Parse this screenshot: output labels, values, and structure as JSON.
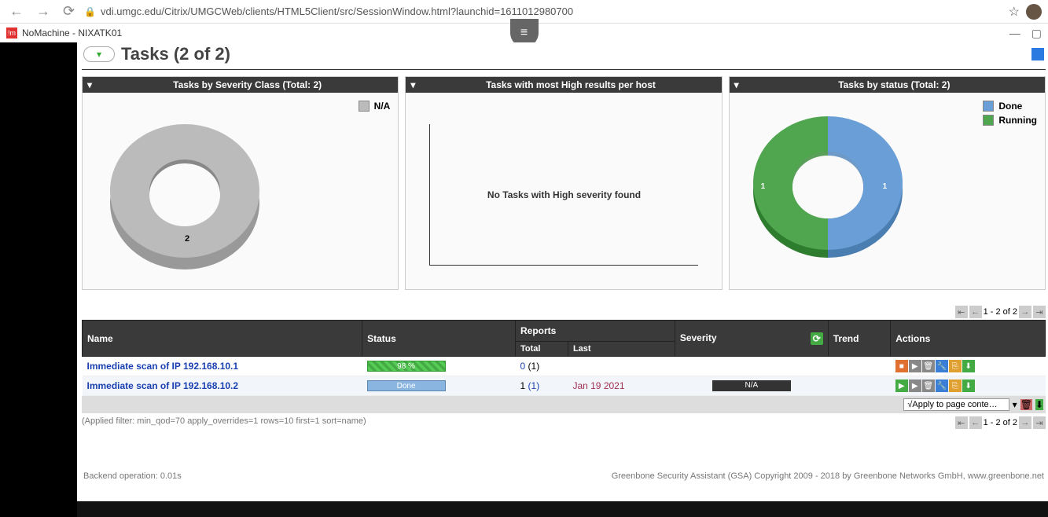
{
  "browser": {
    "url": "vdi.umgc.edu/Citrix/UMGCWeb/clients/HTML5Client/src/SessionWindow.html?launchid=1611012980700"
  },
  "taskbar": {
    "app_title": "NoMachine - NIXATK01"
  },
  "page_title": "Tasks (2 of 2)",
  "panels": {
    "severity": {
      "title": "Tasks by Severity Class (Total: 2)",
      "legend_na": "N/A",
      "count_label": "2"
    },
    "high": {
      "title": "Tasks with most High results per host",
      "empty_msg": "No Tasks with High severity found"
    },
    "status": {
      "title": "Tasks by status (Total: 2)",
      "legend_done": "Done",
      "legend_running": "Running",
      "count_done": "1",
      "count_running": "1"
    }
  },
  "pager": {
    "text": "1 - 2 of 2"
  },
  "table": {
    "headers": {
      "name": "Name",
      "status": "Status",
      "reports": "Reports",
      "total": "Total",
      "last": "Last",
      "severity": "Severity",
      "trend": "Trend",
      "actions": "Actions"
    },
    "rows": [
      {
        "name": "Immediate scan of IP 192.168.10.1",
        "status_pct": "98 %",
        "total_a": "0",
        "total_b": "(1)",
        "last": "",
        "severity": ""
      },
      {
        "name": "Immediate scan of IP 192.168.10.2",
        "status_done": "Done",
        "total_a": "1",
        "total_b": "(1)",
        "last": "Jan 19 2021",
        "severity": "N/A"
      }
    ]
  },
  "apply_dropdown": "√Apply to page conte…",
  "filter_note": "(Applied filter: min_qod=70 apply_overrides=1 rows=10 first=1 sort=name)",
  "backend": "Backend operation: 0.01s",
  "footer": "Greenbone Security Assistant (GSA) Copyright 2009 - 2018 by Greenbone Networks GmbH, www.greenbone.net",
  "chart_data": [
    {
      "type": "pie",
      "title": "Tasks by Severity Class (Total: 2)",
      "series": [
        {
          "name": "N/A",
          "value": 2
        }
      ]
    },
    {
      "type": "bar",
      "title": "Tasks with most High results per host",
      "categories": [],
      "values": [],
      "note": "No Tasks with High severity found"
    },
    {
      "type": "pie",
      "title": "Tasks by status (Total: 2)",
      "series": [
        {
          "name": "Done",
          "value": 1
        },
        {
          "name": "Running",
          "value": 1
        }
      ]
    }
  ]
}
